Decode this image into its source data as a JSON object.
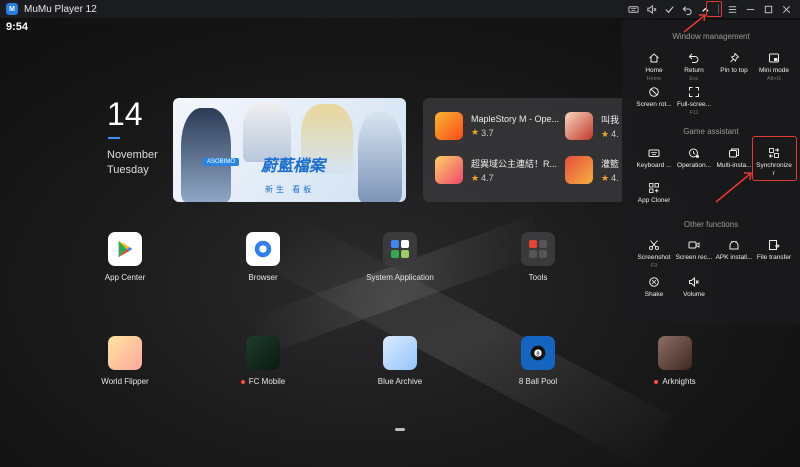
{
  "window": {
    "title": "MuMu Player 12",
    "logo_text": "M"
  },
  "status": {
    "time": "9:54"
  },
  "date_widget": {
    "day_number": "14",
    "month": "November",
    "weekday": "Tuesday"
  },
  "banner": {
    "title": "蔚藍檔案",
    "subtitle": "新生 看板",
    "tag": "ASOBIMO"
  },
  "games": [
    {
      "name": "MapleStory M - Ope...",
      "rating": "3.7"
    },
    {
      "name": "叫我",
      "rating": "4."
    },
    {
      "name": "超異域公主連結！R...",
      "rating": "4.7"
    },
    {
      "name": "灌籃",
      "rating": "4."
    }
  ],
  "apps_row1": [
    {
      "label": "App Center"
    },
    {
      "label": "Browser"
    },
    {
      "label": "System Application"
    },
    {
      "label": "Tools"
    }
  ],
  "apps_row2": [
    {
      "label": "World Flipper",
      "dot": false
    },
    {
      "label": "FC Mobile",
      "dot": true
    },
    {
      "label": "Blue Archive",
      "dot": false
    },
    {
      "label": "8 Ball Pool",
      "dot": false
    },
    {
      "label": "Arknights",
      "dot": true
    }
  ],
  "panel": {
    "window_management": {
      "title": "Window management",
      "items": [
        {
          "label": "Home",
          "key": "Home"
        },
        {
          "label": "Return",
          "key": "Esc"
        },
        {
          "label": "Pin to top",
          "key": ""
        },
        {
          "label": "Mini mode",
          "key": "Alt+G"
        },
        {
          "label": "Screen rot...",
          "key": ""
        },
        {
          "label": "Full-scree...",
          "key": "F11"
        }
      ]
    },
    "game_assistant": {
      "title": "Game assistant",
      "items": [
        {
          "label": "Keyboard ...",
          "key": ""
        },
        {
          "label": "Operation...",
          "key": ""
        },
        {
          "label": "Multi-insta...",
          "key": ""
        },
        {
          "label": "Synchronize",
          "label2": "r",
          "key": ""
        },
        {
          "label": "App Cloner",
          "key": ""
        }
      ]
    },
    "other_functions": {
      "title": "Other functions",
      "items": [
        {
          "label": "Screenshot",
          "key": "F9"
        },
        {
          "label": "Screen rec...",
          "key": ""
        },
        {
          "label": "APK install...",
          "key": ""
        },
        {
          "label": "File transfer",
          "key": ""
        },
        {
          "label": "Shake",
          "key": ""
        },
        {
          "label": "Volume",
          "key": ""
        }
      ]
    }
  },
  "colors": {
    "accent": "#3b8cff",
    "highlight": "#e53935",
    "titlebar": "#1b1c20"
  }
}
